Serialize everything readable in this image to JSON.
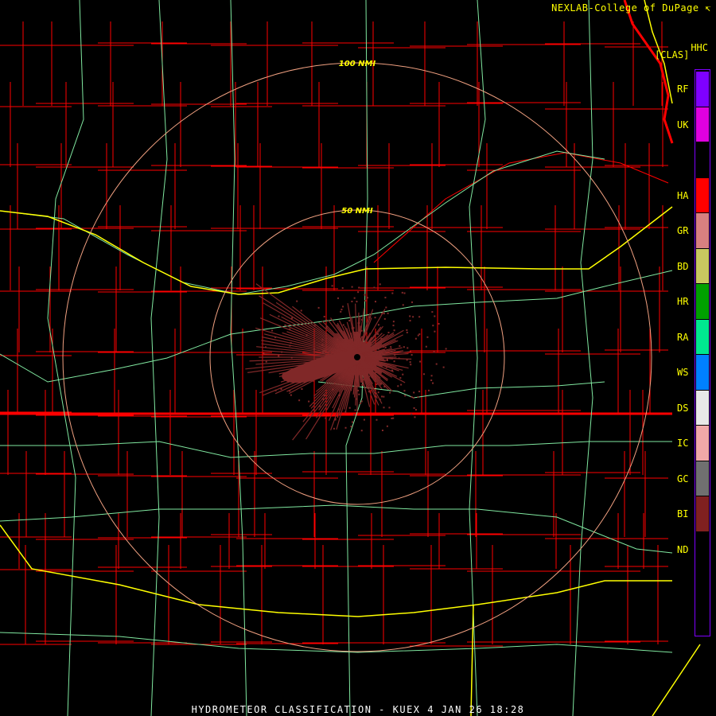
{
  "header": {
    "credit": "NEXLAB-College of DuPage ↸",
    "product_code": "HHC",
    "mode": "[CLAS]"
  },
  "caption": "HYDROMETEOR CLASSIFICATION - KUEX 4 JAN 26 18:28",
  "range_rings": [
    {
      "label": "50 NMI",
      "nmi": 50
    },
    {
      "label": "100 NMI",
      "nmi": 100
    }
  ],
  "legend": [
    {
      "code": "RF",
      "color": "#7f00ff"
    },
    {
      "code": "UK",
      "color": "#e000e0"
    },
    {
      "code": "",
      "color": "#000000"
    },
    {
      "code": "HA",
      "color": "#ff0000"
    },
    {
      "code": "GR",
      "color": "#d88080"
    },
    {
      "code": "BD",
      "color": "#c8c860"
    },
    {
      "code": "HR",
      "color": "#00a000"
    },
    {
      "code": "RA",
      "color": "#00e890"
    },
    {
      "code": "WS",
      "color": "#0080ff"
    },
    {
      "code": "DS",
      "color": "#e8e8e8"
    },
    {
      "code": "IC",
      "color": "#f0a8a8"
    },
    {
      "code": "GC",
      "color": "#707070"
    },
    {
      "code": "BI",
      "color": "#802020"
    },
    {
      "code": "ND",
      "color": "#000000"
    }
  ],
  "colors": {
    "county": "#ff0000",
    "road": "#80e8a0",
    "interstate": "#ffff00",
    "ring": "#f0a080",
    "echo": "#802828"
  }
}
